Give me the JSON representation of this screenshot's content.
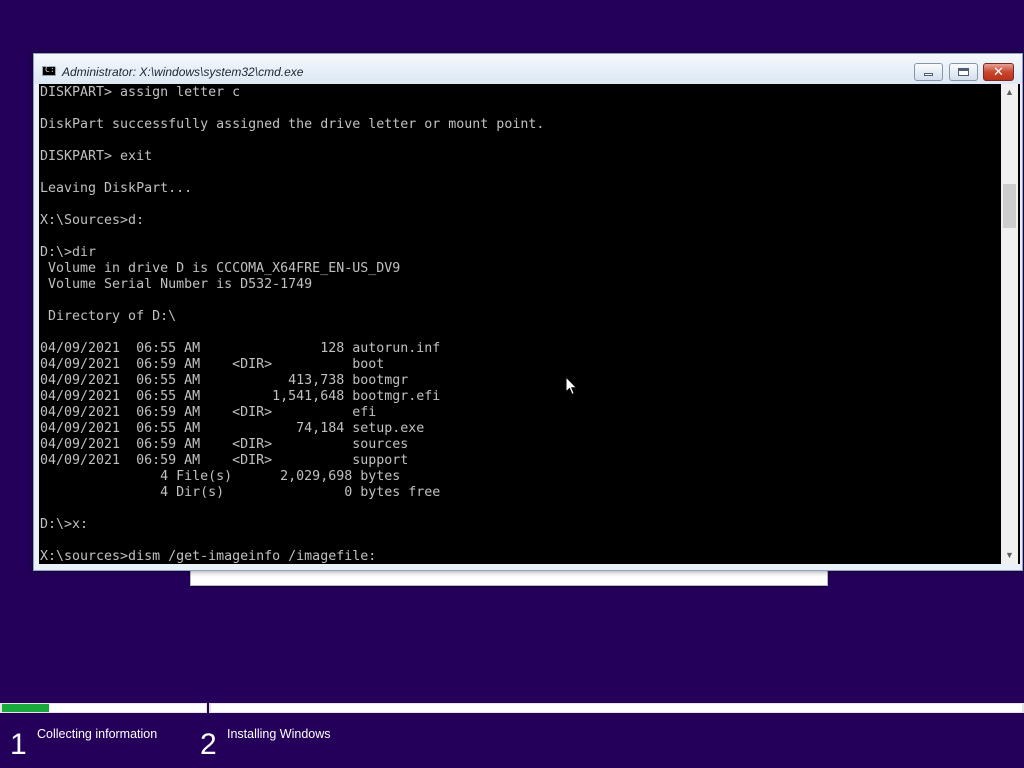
{
  "window": {
    "title": "Administrator: X:\\windows\\system32\\cmd.exe",
    "icon": "cmd-icon",
    "icon_glyph": "C:\\",
    "controls": {
      "minimize": "minimize-icon",
      "maximize": "maximize-icon",
      "close": "✕"
    }
  },
  "console": {
    "background": "#000000",
    "foreground": "#c0c0c0",
    "lines": [
      "DISKPART> assign letter c",
      "",
      "DiskPart successfully assigned the drive letter or mount point.",
      "",
      "DISKPART> exit",
      "",
      "Leaving DiskPart...",
      "",
      "X:\\Sources>d:",
      "",
      "D:\\>dir",
      " Volume in drive D is CCCOMA_X64FRE_EN-US_DV9",
      " Volume Serial Number is D532-1749",
      "",
      " Directory of D:\\",
      "",
      "04/09/2021  06:55 AM               128 autorun.inf",
      "04/09/2021  06:59 AM    <DIR>          boot",
      "04/09/2021  06:55 AM           413,738 bootmgr",
      "04/09/2021  06:55 AM         1,541,648 bootmgr.efi",
      "04/09/2021  06:59 AM    <DIR>          efi",
      "04/09/2021  06:55 AM            74,184 setup.exe",
      "04/09/2021  06:59 AM    <DIR>          sources",
      "04/09/2021  06:59 AM    <DIR>          support",
      "               4 File(s)      2,029,698 bytes",
      "               4 Dir(s)               0 bytes free",
      "",
      "D:\\>x:",
      "",
      "X:\\sources>dism /get-imageinfo /imagefile:"
    ],
    "scrollbar": {
      "up_arrow": "▲",
      "down_arrow": "▼"
    }
  },
  "setup": {
    "background": "#24005a",
    "progress": {
      "step1_fraction": 0.23,
      "fill_color": "#1aaa3c"
    },
    "steps": [
      {
        "number": "1",
        "label": "Collecting information"
      },
      {
        "number": "2",
        "label": "Installing Windows"
      }
    ]
  }
}
